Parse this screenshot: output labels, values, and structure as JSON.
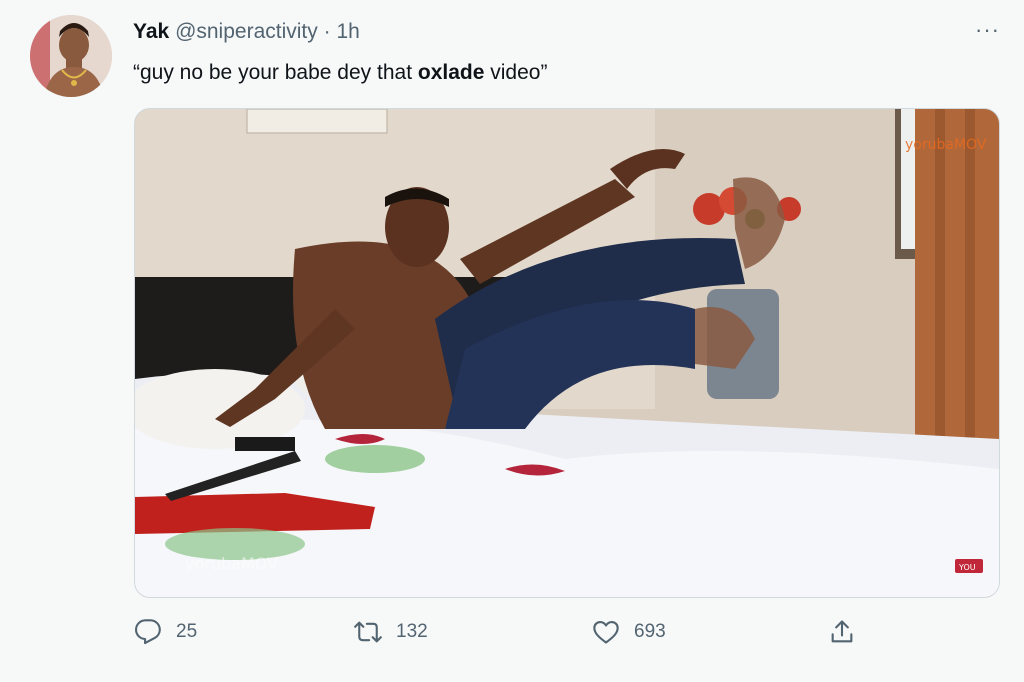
{
  "tweet": {
    "display_name": "Yak",
    "handle": "@sniperactivity",
    "separator": "·",
    "time": "1h",
    "text_before": "“guy no be your babe dey that ",
    "text_bold": "oxlade",
    "text_after": " video”",
    "more_label": "···"
  },
  "media": {
    "watermark": "yorubaMOV",
    "corner_badge": "YOU"
  },
  "actions": {
    "reply_count": "25",
    "retweet_count": "132",
    "like_count": "693"
  },
  "icons": {
    "reply": "reply-icon",
    "retweet": "retweet-icon",
    "like": "heart-icon",
    "share": "share-icon",
    "more": "more-icon"
  },
  "colors": {
    "muted": "#536471",
    "text": "#0f1419",
    "background": "#f7f9f9"
  }
}
